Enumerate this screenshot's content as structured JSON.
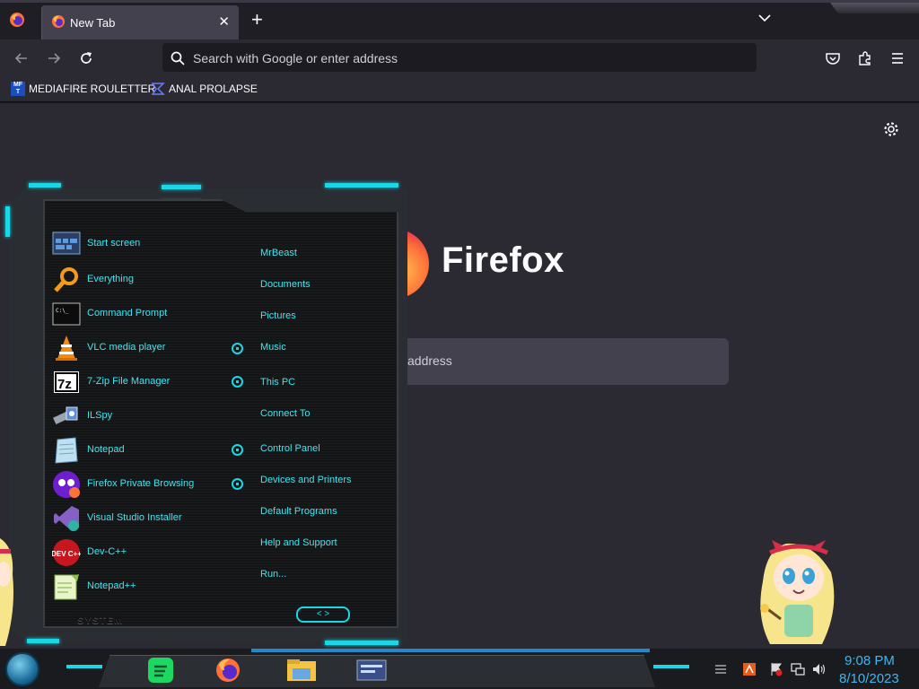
{
  "browser": {
    "tab_title": "New Tab",
    "new_tab_symbol": "+",
    "close_symbol": "✕",
    "urlbar_placeholder": "Search with Google or enter address",
    "bookmarks": [
      {
        "label": "MEDIAFIRE ROULETTER",
        "icon_text": "MF T"
      },
      {
        "label": "ANAL PROLAPSE"
      }
    ]
  },
  "newtab_page": {
    "wordmark": "Firefox",
    "search_placeholder": "address"
  },
  "start_menu": {
    "apps": [
      {
        "label": "Start screen",
        "icon": "start-screen-icon"
      },
      {
        "label": "Everything",
        "icon": "magnifier-icon"
      },
      {
        "label": "Command Prompt",
        "icon": "cmd-icon",
        "icon_text": "C:\\_"
      },
      {
        "label": "VLC media player",
        "icon": "vlc-cone-icon"
      },
      {
        "label": "7-Zip File Manager",
        "icon": "7zip-icon",
        "icon_text": "7z"
      },
      {
        "label": "ILSpy",
        "icon": "ilspy-icon"
      },
      {
        "label": "Notepad",
        "icon": "notepad-icon"
      },
      {
        "label": "Firefox Private Browsing",
        "icon": "firefox-private-icon"
      },
      {
        "label": "Visual Studio Installer",
        "icon": "visual-studio-icon"
      },
      {
        "label": "Dev-C++",
        "icon": "devcpp-icon",
        "icon_text": "DEV C++"
      },
      {
        "label": "Notepad++",
        "icon": "notepadpp-icon"
      }
    ],
    "links": [
      {
        "label": "MrBeast"
      },
      {
        "label": "Documents"
      },
      {
        "label": "Pictures"
      },
      {
        "label": "Music"
      },
      {
        "label": "This PC"
      },
      {
        "label": "Connect To"
      },
      {
        "label": "Control Panel"
      },
      {
        "label": "Devices and Printers"
      },
      {
        "label": "Default Programs"
      },
      {
        "label": "Help and Support"
      },
      {
        "label": "Run..."
      }
    ],
    "footer_label": "SYSTEM",
    "arrows": "< >"
  },
  "taskbar": {
    "clock_time": "9:08 PM",
    "clock_date": "8/10/2023"
  },
  "colors": {
    "accent": "#19d7e6",
    "menu_text": "#3fe6f2",
    "clock_text": "#3fb6f2",
    "browser_bg": "#2b2a33"
  }
}
